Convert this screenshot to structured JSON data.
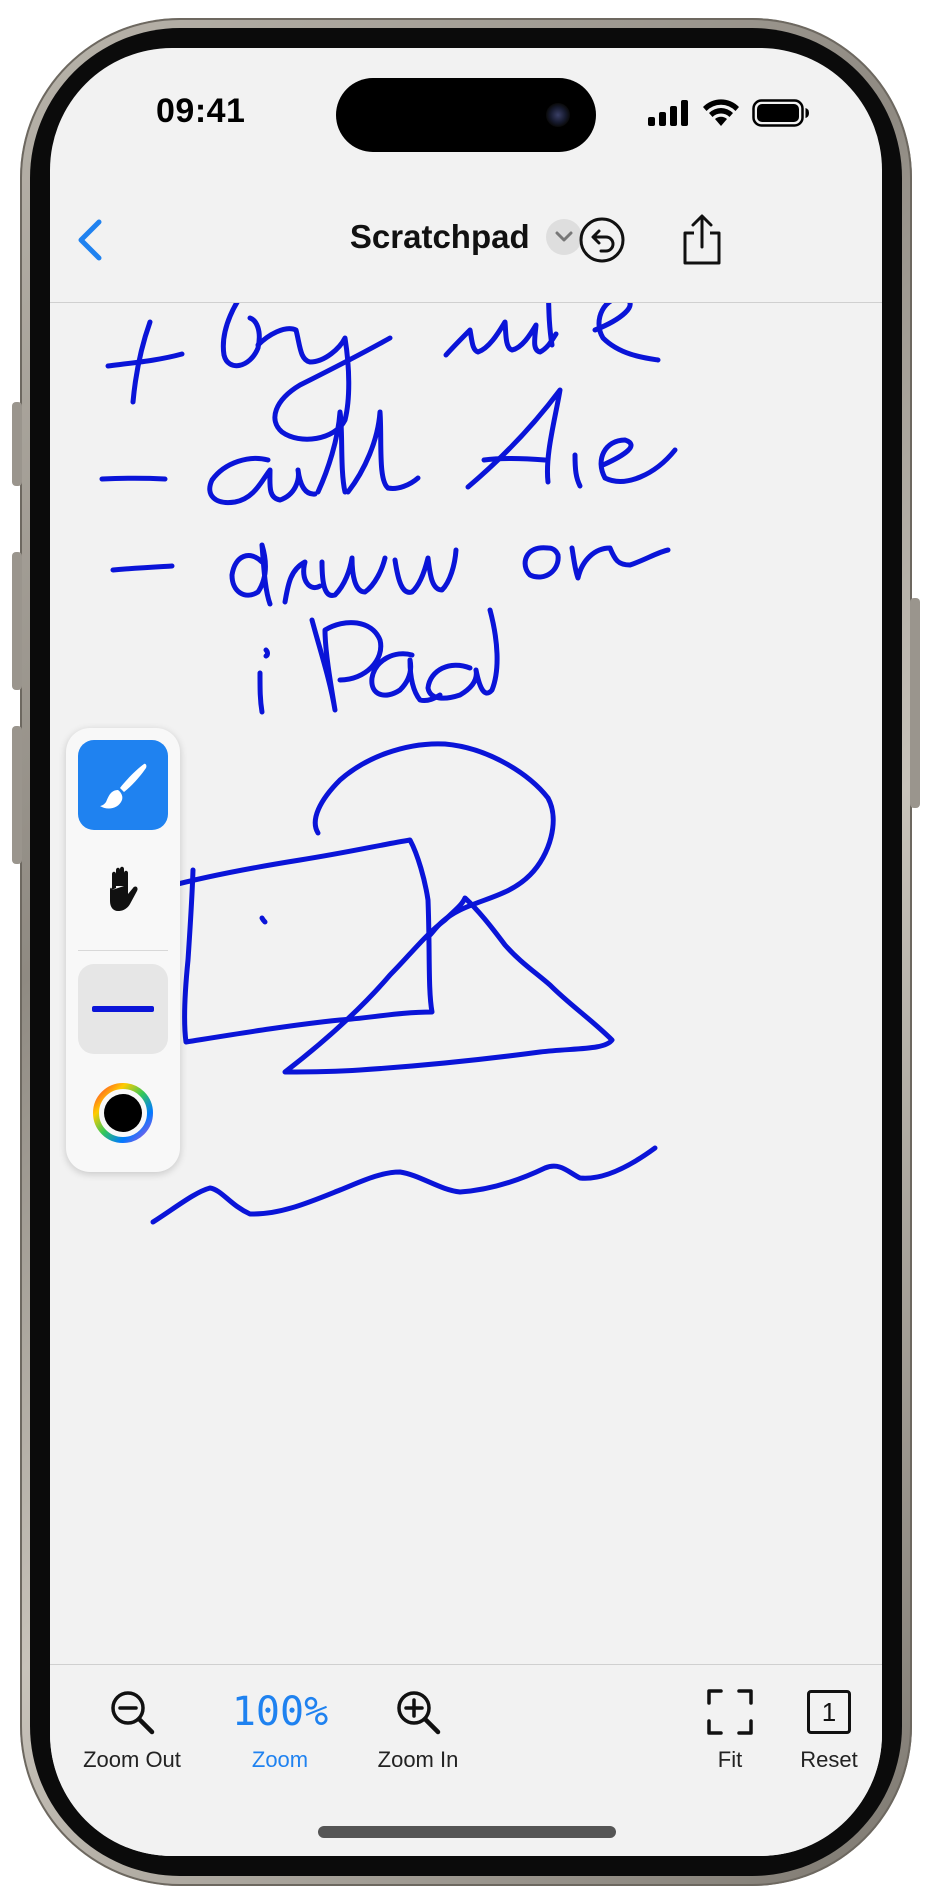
{
  "status_bar": {
    "time": "09:41",
    "icons": [
      "cellular-signal-icon",
      "wifi-icon",
      "battery-icon"
    ]
  },
  "nav_bar": {
    "title": "Scratchpad",
    "back_icon": "chevron-left-icon",
    "title_menu_icon": "chevron-down-icon",
    "undo_icon": "undo-icon",
    "share_icon": "share-icon"
  },
  "tool_palette": {
    "tools": [
      {
        "name": "brush",
        "icon": "paintbrush-icon",
        "selected": true
      },
      {
        "name": "pan",
        "icon": "hand-icon",
        "selected": false
      }
    ],
    "stroke_width": "line-width-icon",
    "color_picker": "color-wheel-icon"
  },
  "bottom_toolbar": {
    "zoom_out_label": "Zoom Out",
    "zoom_value": "100%",
    "zoom_label": "Zoom",
    "zoom_in_label": "Zoom In",
    "fit_label": "Fit",
    "reset_label": "Reset",
    "reset_icon_text": "1"
  },
  "colors": {
    "accent": "#1f82f0",
    "ink": "#0a14d8",
    "background": "#f2f2f2"
  }
}
